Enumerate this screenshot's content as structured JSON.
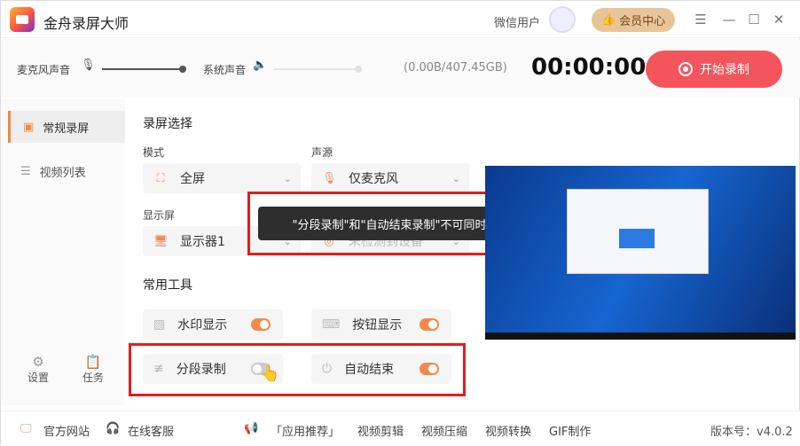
{
  "app": {
    "title": "金舟录屏大师",
    "user": "微信用户",
    "vip": "会员中心"
  },
  "toolbar": {
    "mic_label": "麦克风声音",
    "sys_label": "系统声音",
    "storage": "(0.00B/407.45GB)",
    "timer": "00:00:00",
    "record": "开始录制",
    "mic_level": 1.0,
    "sys_level": 1.0
  },
  "sidebar": {
    "items": [
      {
        "label": "常规录屏"
      },
      {
        "label": "视频列表"
      }
    ],
    "settings": "设置",
    "tasks": "任务"
  },
  "main": {
    "section1": "录屏选择",
    "mode_label": "模式",
    "mode_value": "全屏",
    "source_label": "声源",
    "source_value": "仅麦克风",
    "display_label": "显示屏",
    "display_value": "显示器1",
    "camera_value": "未检测到设备",
    "section2": "常用工具",
    "tools": [
      {
        "label": "水印显示",
        "on": true
      },
      {
        "label": "按钮显示",
        "on": true
      },
      {
        "label": "分段录制",
        "on": false
      },
      {
        "label": "自动结束",
        "on": true
      }
    ]
  },
  "tooltip": "\"分段录制\"和\"自动结束录制\"不可同时使用",
  "footer": {
    "website": "官方网站",
    "support": "在线客服",
    "recommend": "「应用推荐」",
    "links": [
      "视频剪辑",
      "视频压缩",
      "视频转换",
      "GIF制作"
    ],
    "version": "版本号：v4.0.2"
  }
}
